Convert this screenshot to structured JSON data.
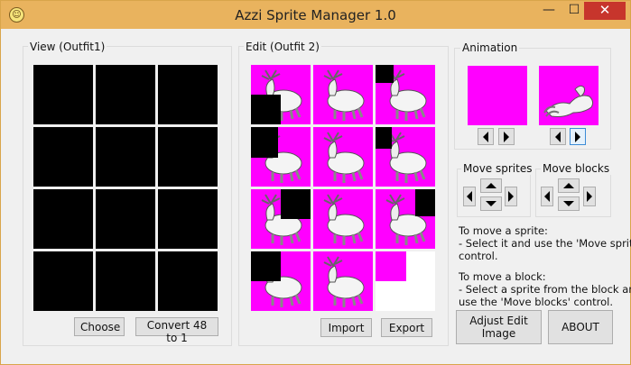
{
  "window": {
    "title": "Azzi Sprite Manager 1.0",
    "app_icon": "app-icon",
    "controls": {
      "minimize": "—",
      "maximize": "☐",
      "close": "✕"
    }
  },
  "view_panel": {
    "label": "View (Outfit1)",
    "choose_button": "Choose",
    "convert_button": "Convert 48 to 1"
  },
  "edit_panel": {
    "label": "Edit (Outfit 2)",
    "import_button": "Import",
    "export_button": "Export"
  },
  "animation_panel": {
    "label": "Animation"
  },
  "move_sprites": {
    "label": "Move sprites"
  },
  "move_blocks": {
    "label": "Move blocks"
  },
  "help": {
    "sprite_title": "To move a sprite:",
    "sprite_line1": " - Select it and use the 'Move sprites'",
    "sprite_line2": "control.",
    "block_title": "To move a block:",
    "block_line1": " - Select a sprite from the block and",
    "block_line2": "use the 'Move blocks' control."
  },
  "buttons": {
    "adjust": "Adjust Edit Image",
    "about": "ABOUT"
  },
  "colors": {
    "titlebar": "#e9b35e",
    "close": "#c7352c",
    "sprite_background": "#ff00ff",
    "empty_cell": "#000000"
  }
}
